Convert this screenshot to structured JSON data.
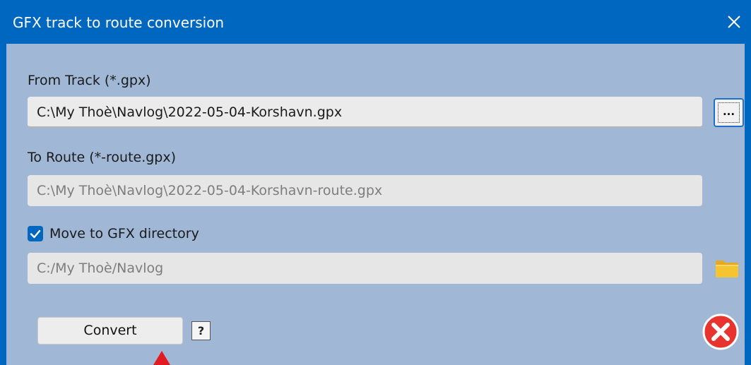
{
  "window": {
    "title": "GFX track to route conversion"
  },
  "from_track": {
    "label": "From Track (*.gpx)",
    "value": "C:\\My Thoè\\Navlog\\2022-05-04-Korshavn.gpx",
    "browse_label": "..."
  },
  "to_route": {
    "label": "To Route (*-route.gpx)",
    "value": "C:\\My Thoè\\Navlog\\2022-05-04-Korshavn-route.gpx"
  },
  "move_option": {
    "label": "Move to GFX directory",
    "checked": true,
    "directory": "C:/My Thoè/Navlog"
  },
  "actions": {
    "convert_label": "Convert",
    "help_label": "?"
  },
  "icons": {
    "close": "close-icon",
    "folder": "folder-icon",
    "cancel": "cancel-icon",
    "check": "check-icon"
  },
  "colors": {
    "titlebar": "#0067c0",
    "background": "#a0b8d6",
    "cancel_red": "#e8342e",
    "folder_yellow": "#f5c431"
  }
}
